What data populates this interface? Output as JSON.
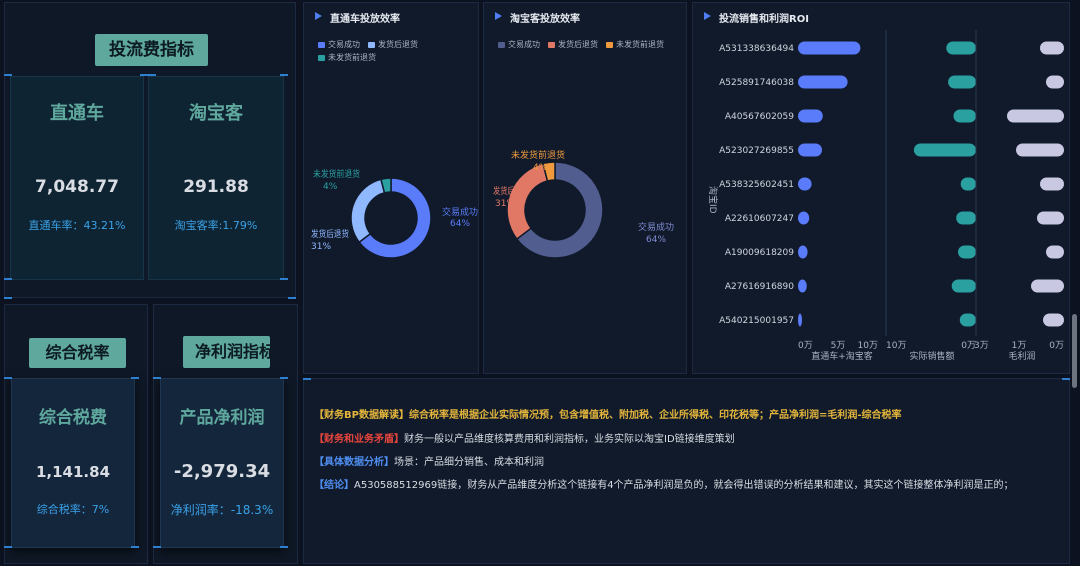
{
  "left_top": {
    "section_title": "投流费指标",
    "cards": [
      {
        "label": "直通车",
        "value": "7,048.77",
        "rate": "直通车率：43.21%"
      },
      {
        "label": "淘宝客",
        "value": "291.88",
        "rate": "淘宝客率:1.79%"
      }
    ]
  },
  "left_bottom": {
    "tax": {
      "section_title": "综合税率",
      "label": "综合税费",
      "value": "1,141.84",
      "rate": "综合税率：7%"
    },
    "profit": {
      "section_title": "净利润指标",
      "label": "产品净利润",
      "value": "-2,979.34",
      "rate": "净利润率：-18.3%"
    }
  },
  "colors": {
    "success": "#5b7cfa",
    "shipped_return": "#8fb8ff",
    "unshipped_return": "#2aa0a0",
    "tk_success": "#515d8e",
    "tk_shipped": "#e07865",
    "tk_unshipped": "#ef9a3e",
    "roi_a": "#5b7cfa",
    "roi_b": "#2aa0a0",
    "roi_c": "#c9c8e2"
  },
  "chart_data": [
    {
      "type": "pie",
      "title": "直通车投放效率",
      "legend": [
        "交易成功",
        "发货后退货",
        "未发货前退货"
      ],
      "slices": [
        {
          "label": "交易成功",
          "value": 64,
          "pct": "64%"
        },
        {
          "label": "发货后退货",
          "value": 31,
          "pct": "31%"
        },
        {
          "label": "未发货前退货",
          "value": 4,
          "pct": "4%"
        }
      ]
    },
    {
      "type": "pie",
      "title": "淘宝客投放效率",
      "legend": [
        "交易成功",
        "发货后退货",
        "未发货前退货"
      ],
      "slices": [
        {
          "label": "交易成功",
          "value": 64,
          "pct": "64%"
        },
        {
          "label": "发货后退货",
          "value": 31,
          "pct": "31%"
        },
        {
          "label": "未发货前退货",
          "value": 4,
          "pct": "4%"
        }
      ]
    },
    {
      "type": "bar",
      "title": "投流销售和利润ROI",
      "ylabel": "淘宝ID",
      "categories": [
        "A531338636494",
        "A525891746038",
        "A40567602059",
        "A523027269855",
        "A538325602451",
        "A22610607247",
        "A19009618209",
        "A27616916890",
        "A540215001957"
      ],
      "panels": [
        {
          "xlabel": "直通车+淘宝客",
          "ticks": [
            "0万",
            "5万",
            "10万"
          ],
          "xlim": [
            0,
            100000
          ],
          "values": [
            78000,
            62000,
            31000,
            30000,
            17000,
            14000,
            12000,
            11000,
            3000
          ]
        },
        {
          "xlabel": "实际销售额",
          "ticks": [
            "10万",
            "0万"
          ],
          "xlim": [
            0,
            100000
          ],
          "values": [
            33000,
            31000,
            25000,
            69000,
            17000,
            22000,
            20000,
            27000,
            18000
          ]
        },
        {
          "xlabel": "毛利润",
          "ticks": [
            "3万",
            "1万",
            "0万"
          ],
          "xlim": [
            0,
            30000
          ],
          "values": [
            8000,
            6000,
            19000,
            16000,
            8000,
            9000,
            6000,
            11000,
            7000
          ]
        }
      ]
    }
  ],
  "notes": [
    {
      "tag": "【财务BP数据解读】",
      "text": "综合税率是根据企业实际情况预，包含增值税、附加税、企业所得税、印花税等；产品净利润=毛利润-综合税率",
      "tag_color": "#e3b53b",
      "text_color": "#e3b53b"
    },
    {
      "tag": "【财务和业务矛盾】",
      "text": "财务一般以产品维度核算费用和利润指标，业务实际以淘宝ID链接维度策划",
      "tag_color": "#e8453c",
      "text_color": "#d9dde3"
    },
    {
      "tag": "【具体数据分析】",
      "text": "场景：产品细分销售、成本和利润",
      "tag_color": "#4f8ef0",
      "text_color": "#d9dde3"
    },
    {
      "tag": "【结论】",
      "text": "A530588512969链接，财务从产品维度分析这个链接有4个产品净利润是负的，就会得出错误的分析结果和建议，其实这个链接整体净利润是正的；",
      "tag_color": "#4f8ef0",
      "text_color": "#d9dde3"
    }
  ]
}
